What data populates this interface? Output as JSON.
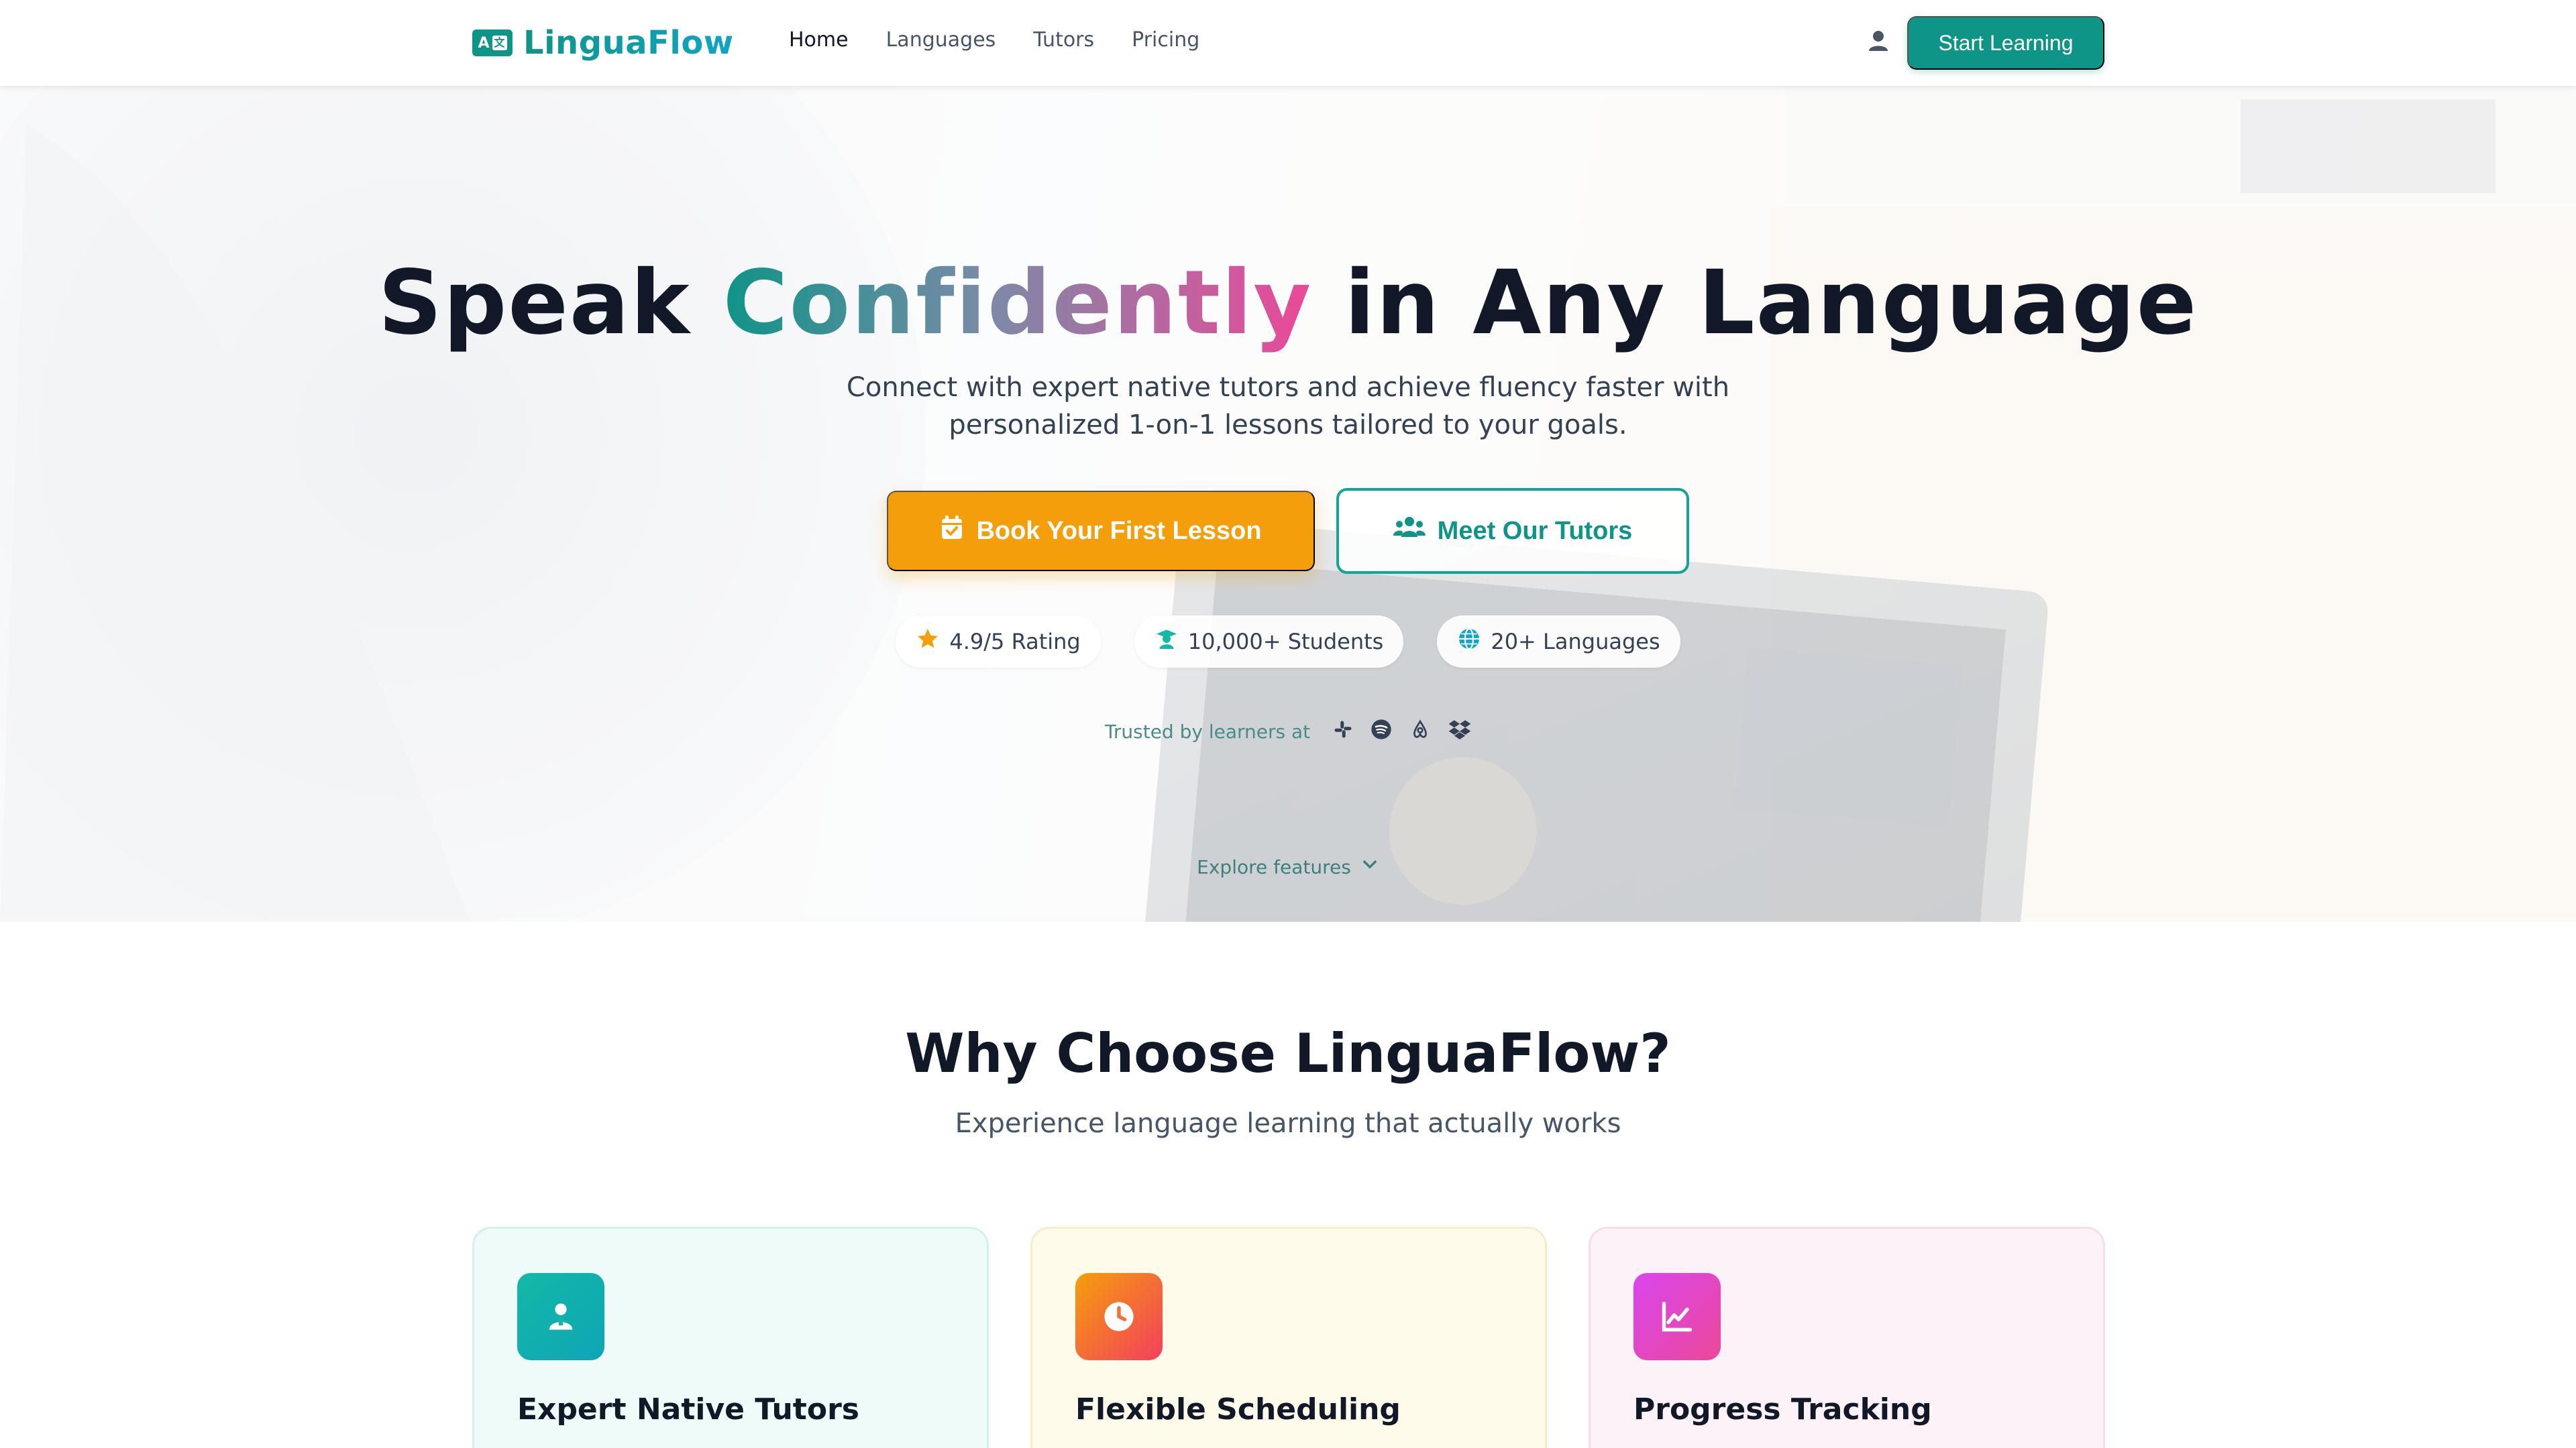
{
  "nav": {
    "brand_icon_text": "A",
    "brand_icon_box": "文",
    "brand": "LinguaFlow",
    "links": [
      {
        "label": "Home",
        "active": true
      },
      {
        "label": "Languages",
        "active": false
      },
      {
        "label": "Tutors",
        "active": false
      },
      {
        "label": "Pricing",
        "active": false
      }
    ],
    "user_icon": "user-icon",
    "cta": "Start Learning"
  },
  "hero": {
    "title_pre": "Speak ",
    "title_highlight": "Confidently",
    "title_post": " in Any Language",
    "subtitle_line1": "Connect with expert native tutors and achieve fluency faster with",
    "subtitle_line2": "personalized 1-on-1 lessons tailored to your goals.",
    "primary_button": "Book Your First Lesson",
    "secondary_button": "Meet Our Tutors",
    "stats": [
      {
        "label": "4.9/5 Rating",
        "icon": "star-icon"
      },
      {
        "label": "10,000+ Students",
        "icon": "graduate-icon"
      },
      {
        "label": "20+ Languages",
        "icon": "globe-icon"
      }
    ],
    "trusted_text": "Trusted by learners at",
    "trusted_logos": [
      "slack-icon",
      "spotify-icon",
      "airbnb-icon",
      "dropbox-icon"
    ],
    "explore_text": "Explore features"
  },
  "why": {
    "title": "Why Choose LinguaFlow?",
    "subtitle": "Experience language learning that actually works",
    "cards": [
      {
        "title": "Expert Native Tutors",
        "icon": "tutor-icon"
      },
      {
        "title": "Flexible Scheduling",
        "icon": "clock-icon"
      },
      {
        "title": "Progress Tracking",
        "icon": "chart-line-icon"
      }
    ]
  },
  "colors": {
    "primary": "#0f9488",
    "accent": "#f59e0b",
    "pink": "#ec4899",
    "text": "#0f172a"
  }
}
